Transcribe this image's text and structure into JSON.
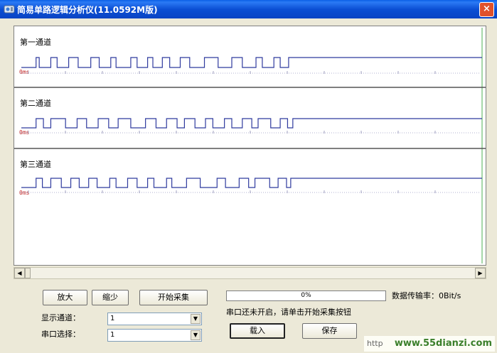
{
  "window": {
    "title": "简易单路逻辑分析仪(11.0592M版)",
    "close_symbol": "×"
  },
  "channels": [
    {
      "label": "第一通道",
      "time_label": "0ms",
      "transitions": [
        0,
        14,
        17,
        28,
        34,
        45,
        54,
        66,
        74,
        85,
        90,
        104,
        110,
        120,
        125,
        134,
        141,
        151,
        160,
        174,
        187,
        200,
        210,
        223,
        229,
        240,
        246,
        254
      ],
      "start_high": false
    },
    {
      "label": "第二通道",
      "time_label": "0ms",
      "transitions": [
        0,
        14,
        21,
        28,
        42,
        53,
        62,
        73,
        83,
        92,
        104,
        118,
        128,
        138,
        148,
        155,
        165,
        175,
        182,
        193,
        200,
        210,
        219,
        225,
        237,
        246,
        253,
        258
      ],
      "start_high": false
    },
    {
      "label": "第三通道",
      "time_label": "0ms",
      "transitions": [
        0,
        14,
        20,
        28,
        38,
        47,
        55,
        64,
        72,
        84,
        90,
        101,
        110,
        120,
        126,
        138,
        143,
        157,
        170,
        186,
        194,
        207,
        216,
        222,
        236,
        244,
        252,
        256
      ],
      "start_high": false
    }
  ],
  "controls": {
    "zoom_in_label": "放大",
    "zoom_out_label": "缩少",
    "start_capture_label": "开始采集",
    "load_label": "载入",
    "save_label": "保存",
    "display_channel_label": "显示通道：",
    "display_channel_value": "1",
    "serial_port_label": "串口选择：",
    "serial_port_value": "1",
    "progress_text": "0%",
    "progress_value": 0,
    "rate_label": "数据传输率：0Bit/s",
    "status_text": "串口还未开启，请单击开始采集按钮"
  },
  "watermark": {
    "prefix": "http",
    "site": "www.55dianzi.com"
  },
  "colors": {
    "wave": "#2f3a9e",
    "ms": "#c02020",
    "title_bar": "#0b4fd4"
  }
}
